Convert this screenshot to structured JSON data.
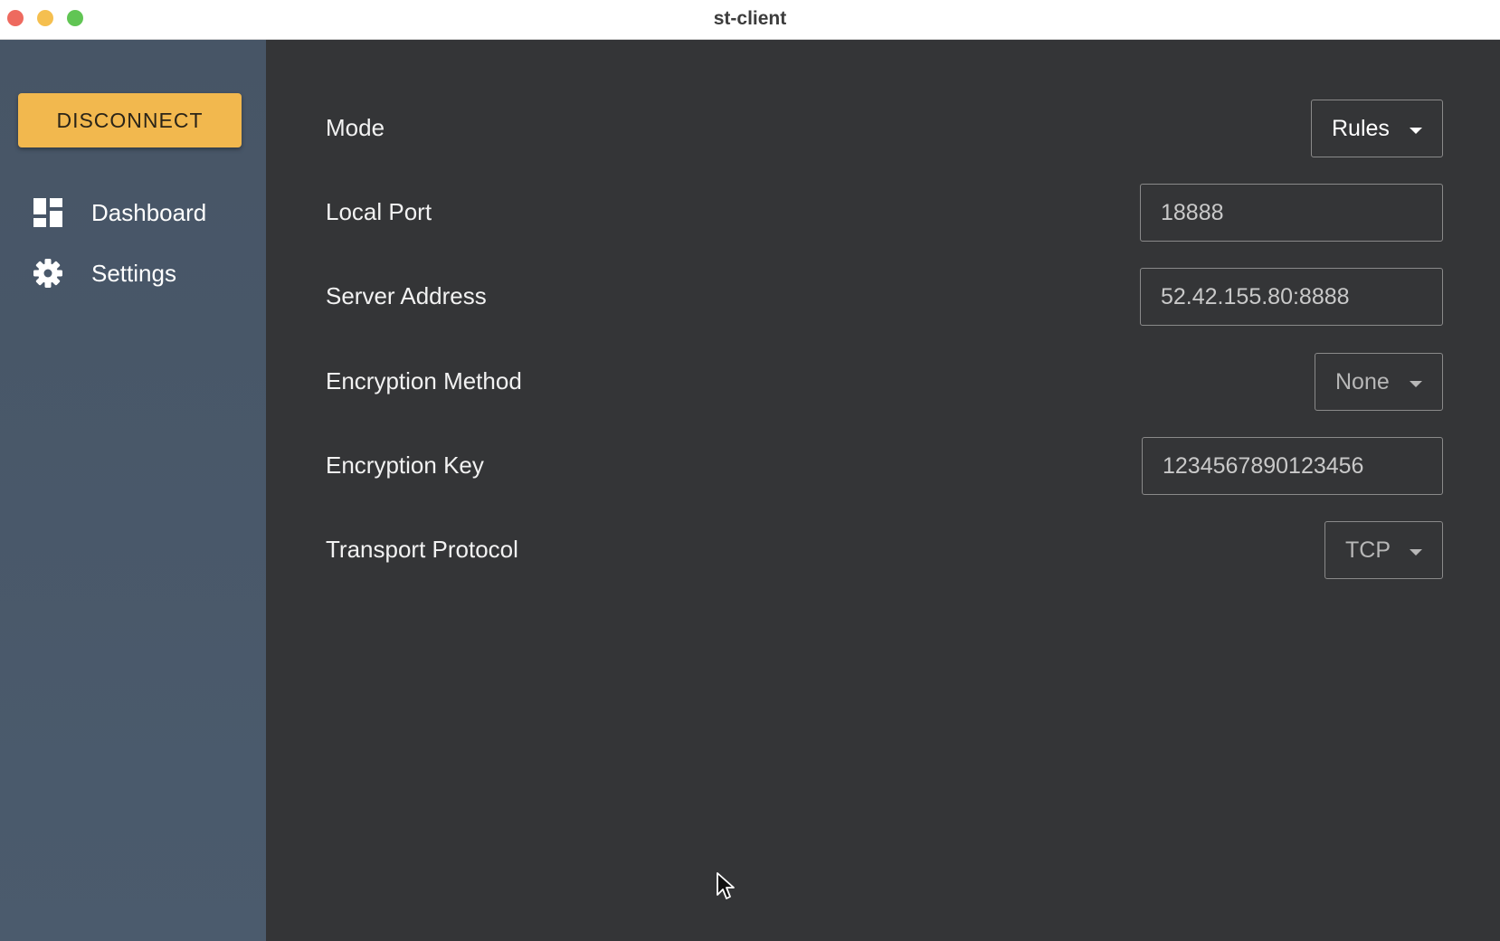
{
  "window": {
    "title": "st-client"
  },
  "sidebar": {
    "disconnect_label": "DISCONNECT",
    "accent_color": "#f2b84e",
    "items": [
      {
        "label": "Dashboard",
        "icon": "dashboard-icon"
      },
      {
        "label": "Settings",
        "icon": "gear-icon"
      }
    ]
  },
  "settings": {
    "mode": {
      "label": "Mode",
      "value": "Rules"
    },
    "local_port": {
      "label": "Local Port",
      "value": "18888"
    },
    "server_address": {
      "label": "Server Address",
      "value": "52.42.155.80:8888"
    },
    "encryption_method": {
      "label": "Encryption Method",
      "value": "None"
    },
    "encryption_key": {
      "label": "Encryption Key",
      "value": "1234567890123456"
    },
    "transport_protocol": {
      "label": "Transport Protocol",
      "value": "TCP"
    }
  }
}
